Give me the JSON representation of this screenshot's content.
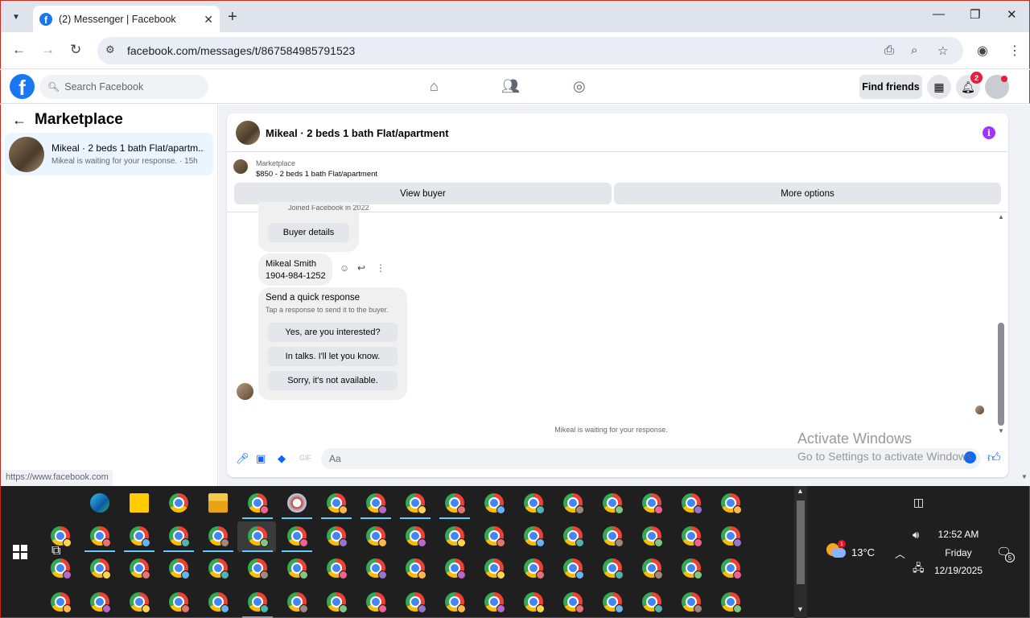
{
  "browser": {
    "tab_title": "(2) Messenger | Facebook",
    "url": "facebook.com/messages/t/867584985791523",
    "new_tab_label": "+",
    "tab_close": "✕"
  },
  "fb": {
    "search_placeholder": "Search Facebook",
    "find_friends": "Find friends",
    "notification_count": "2"
  },
  "left": {
    "title": "Marketplace",
    "conversation": {
      "name": "Mikeal · 2 beds 1 bath Flat/apartm...",
      "subtitle": "Mikeal is waiting for your response. · 15h"
    },
    "status_url": "https://www.facebook.com"
  },
  "chat": {
    "header_title": "Mikeal · 2 beds 1 bath Flat/apartment",
    "marketplace_label": "Marketplace",
    "listing": "$850 - 2 beds 1 bath Flat/apartment",
    "view_buyer": "View buyer",
    "more_options": "More options",
    "joined_cut": "Joined Facebook in 2022",
    "buyer_details": "Buyer details",
    "contact_name": "Mikeal Smith",
    "contact_phone": "1904-984-1252",
    "quick_title": "Send a quick response",
    "quick_sub": "Tap a response to send it to the buyer.",
    "quick_responses": [
      "Yes, are you interested?",
      "In talks. I'll let you know.",
      "Sorry, it's not available."
    ],
    "waiting": "Mikeal is waiting for your response.",
    "composer_placeholder": "Aa"
  },
  "watermark": {
    "line1": "Activate Windows",
    "line2": "Go to Settings to activate Windows."
  },
  "taskbar": {
    "temperature": "13°C",
    "weather_badge": "1",
    "time": "12:52 AM",
    "day": "Friday",
    "date": "12/19/2025",
    "notification_count": "5"
  },
  "accent_colors": {
    "facebook_blue": "#1877f2",
    "messenger_blue": "#0866ff",
    "info_purple": "#a033ff",
    "badge_red": "#e41e3f"
  }
}
